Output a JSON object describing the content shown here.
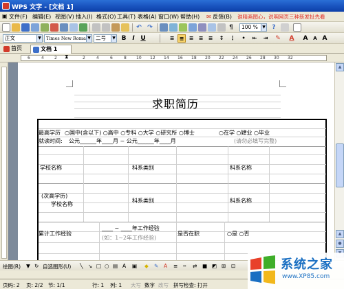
{
  "window": {
    "title": "WPS 文字 - [文档 1]"
  },
  "menu": {
    "items": [
      "文件(F)",
      "编辑(E)",
      "视图(V)",
      "插入(I)",
      "格式(O)",
      "工具(T)",
      "表格(A)",
      "窗口(W)",
      "帮助(H)"
    ],
    "feedback": "反馈(B)",
    "promo": "谁精画图心，说明网页三种新发扯先看"
  },
  "toolbar2": {
    "style": "正文",
    "font": "Times New Roman",
    "size": "二号",
    "zoom": "100 %"
  },
  "tabs": [
    {
      "label": "首页"
    },
    {
      "label": "文档 1"
    }
  ],
  "ruler": {
    "numbers": [
      "6",
      "4",
      "2",
      "2",
      "4",
      "6",
      "8",
      "10",
      "12",
      "14",
      "16",
      "18",
      "20",
      "22",
      "24",
      "26",
      "28",
      "30",
      "32"
    ]
  },
  "document": {
    "title": "求职简历",
    "row1": {
      "label": "最高学历",
      "options": "○国中(含以下) ○高中  ○专科  ○大学  ○研究所  ○博士",
      "status": "○在学 ○肄业 ○毕业"
    },
    "row2": {
      "label": "就读时间:",
      "text": "公元______年____月 ~ 公元______年____月",
      "hint": "(请勿必填写完整)"
    },
    "school1": {
      "name_label": "学校名称",
      "dept_label": "科系类别",
      "dept_name_label": "科系名称"
    },
    "school2": {
      "name_label_line1": "(次高学历)",
      "name_label_line2": "学校名称",
      "dept_label": "科系类别",
      "dept_name_label": "科系名称"
    },
    "work": {
      "label": "累计工作经验",
      "range": "____ ~ ____年工作经验",
      "hint": "(如：1~2年工作经验)",
      "current_label": "是否在职",
      "current_options": "○是  ○否"
    }
  },
  "drawbar": {
    "draw": "绘图(R)",
    "autoshape": "自选图形(U)"
  },
  "status": {
    "page": "页码: 2",
    "pages": "页: 2/2",
    "section": "节: 1/1",
    "line": "行: 1",
    "col": "列: 1",
    "caps": "大写",
    "num": "数字",
    "ovr": "改写",
    "spell": "拼写检查: 打开"
  },
  "watermark": {
    "brand": "系统之家",
    "url": "www.XP85.com"
  },
  "colors": {
    "titlebar": "#1a55c0",
    "promo": "#e0302a",
    "brand": "#1a6fc2"
  }
}
